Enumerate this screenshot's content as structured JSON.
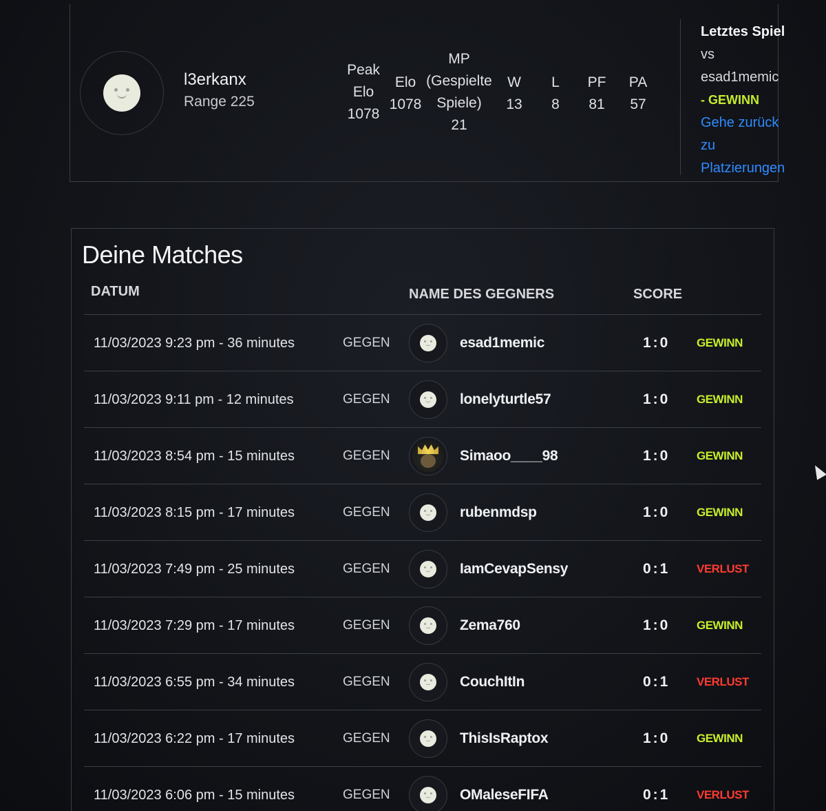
{
  "profile": {
    "username": "l3erkanx",
    "rank": "Range 225",
    "stats": [
      {
        "label": [
          "Peak",
          "Elo"
        ],
        "value": "1078"
      },
      {
        "label": [
          "Elo"
        ],
        "value": "1078"
      },
      {
        "label": [
          "MP",
          "(Gespielte",
          "Spiele)"
        ],
        "value": "21"
      },
      {
        "label": [
          "W"
        ],
        "value": "13"
      },
      {
        "label": [
          "L"
        ],
        "value": "8"
      },
      {
        "label": [
          "PF"
        ],
        "value": "81"
      },
      {
        "label": [
          "PA"
        ],
        "value": "57"
      }
    ],
    "last_game": {
      "title": "Letztes Spiel",
      "vs": "vs",
      "opponent": "esad1memic",
      "result": "- GEWINN",
      "link": [
        "Gehe zurück",
        "zu",
        "Platzierungen"
      ]
    }
  },
  "matches": {
    "title": "Deine Matches",
    "headers": {
      "date": "DATUM",
      "opponent": "NAME DES GEGNERS",
      "score": "SCORE"
    },
    "rows": [
      {
        "date": "11/03/2023 9:23 pm - 36 minutes",
        "vs": "GEGEN",
        "avatar": "smiley-avatar",
        "opponent": "esad1memic",
        "score": "1:0",
        "result": "GEWINN",
        "status": "win"
      },
      {
        "date": "11/03/2023 9:11 pm - 12 minutes",
        "vs": "GEGEN",
        "avatar": "smiley-avatar",
        "opponent": "lonelyturtle57",
        "score": "1:0",
        "result": "GEWINN",
        "status": "win"
      },
      {
        "date": "11/03/2023 8:54 pm - 15 minutes",
        "vs": "GEGEN",
        "avatar": "crown-avatar",
        "opponent": "Simaoo____98",
        "score": "1:0",
        "result": "GEWINN",
        "status": "win"
      },
      {
        "date": "11/03/2023 8:15 pm - 17 minutes",
        "vs": "GEGEN",
        "avatar": "smiley-avatar",
        "opponent": "rubenmdsp",
        "score": "1:0",
        "result": "GEWINN",
        "status": "win"
      },
      {
        "date": "11/03/2023 7:49 pm - 25 minutes",
        "vs": "GEGEN",
        "avatar": "smiley-avatar",
        "opponent": "IamCevapSensy",
        "score": "0:1",
        "result": "VERLUST",
        "status": "loss"
      },
      {
        "date": "11/03/2023 7:29 pm - 17 minutes",
        "vs": "GEGEN",
        "avatar": "smiley-avatar",
        "opponent": "Zema760",
        "score": "1:0",
        "result": "GEWINN",
        "status": "win"
      },
      {
        "date": "11/03/2023 6:55 pm - 34 minutes",
        "vs": "GEGEN",
        "avatar": "smiley-avatar",
        "opponent": "CouchItIn",
        "score": "0:1",
        "result": "VERLUST",
        "status": "loss"
      },
      {
        "date": "11/03/2023 6:22 pm - 17 minutes",
        "vs": "GEGEN",
        "avatar": "smiley-avatar",
        "opponent": "ThisIsRaptox",
        "score": "1:0",
        "result": "GEWINN",
        "status": "win"
      },
      {
        "date": "11/03/2023 6:06 pm - 15 minutes",
        "vs": "GEGEN",
        "avatar": "smiley-avatar",
        "opponent": "OMaleseFIFA",
        "score": "0:1",
        "result": "VERLUST",
        "status": "loss"
      }
    ]
  },
  "colors": {
    "win": "#c8ef2a",
    "loss": "#ff3b30",
    "link": "#2f8bff",
    "background": "#15171c"
  }
}
